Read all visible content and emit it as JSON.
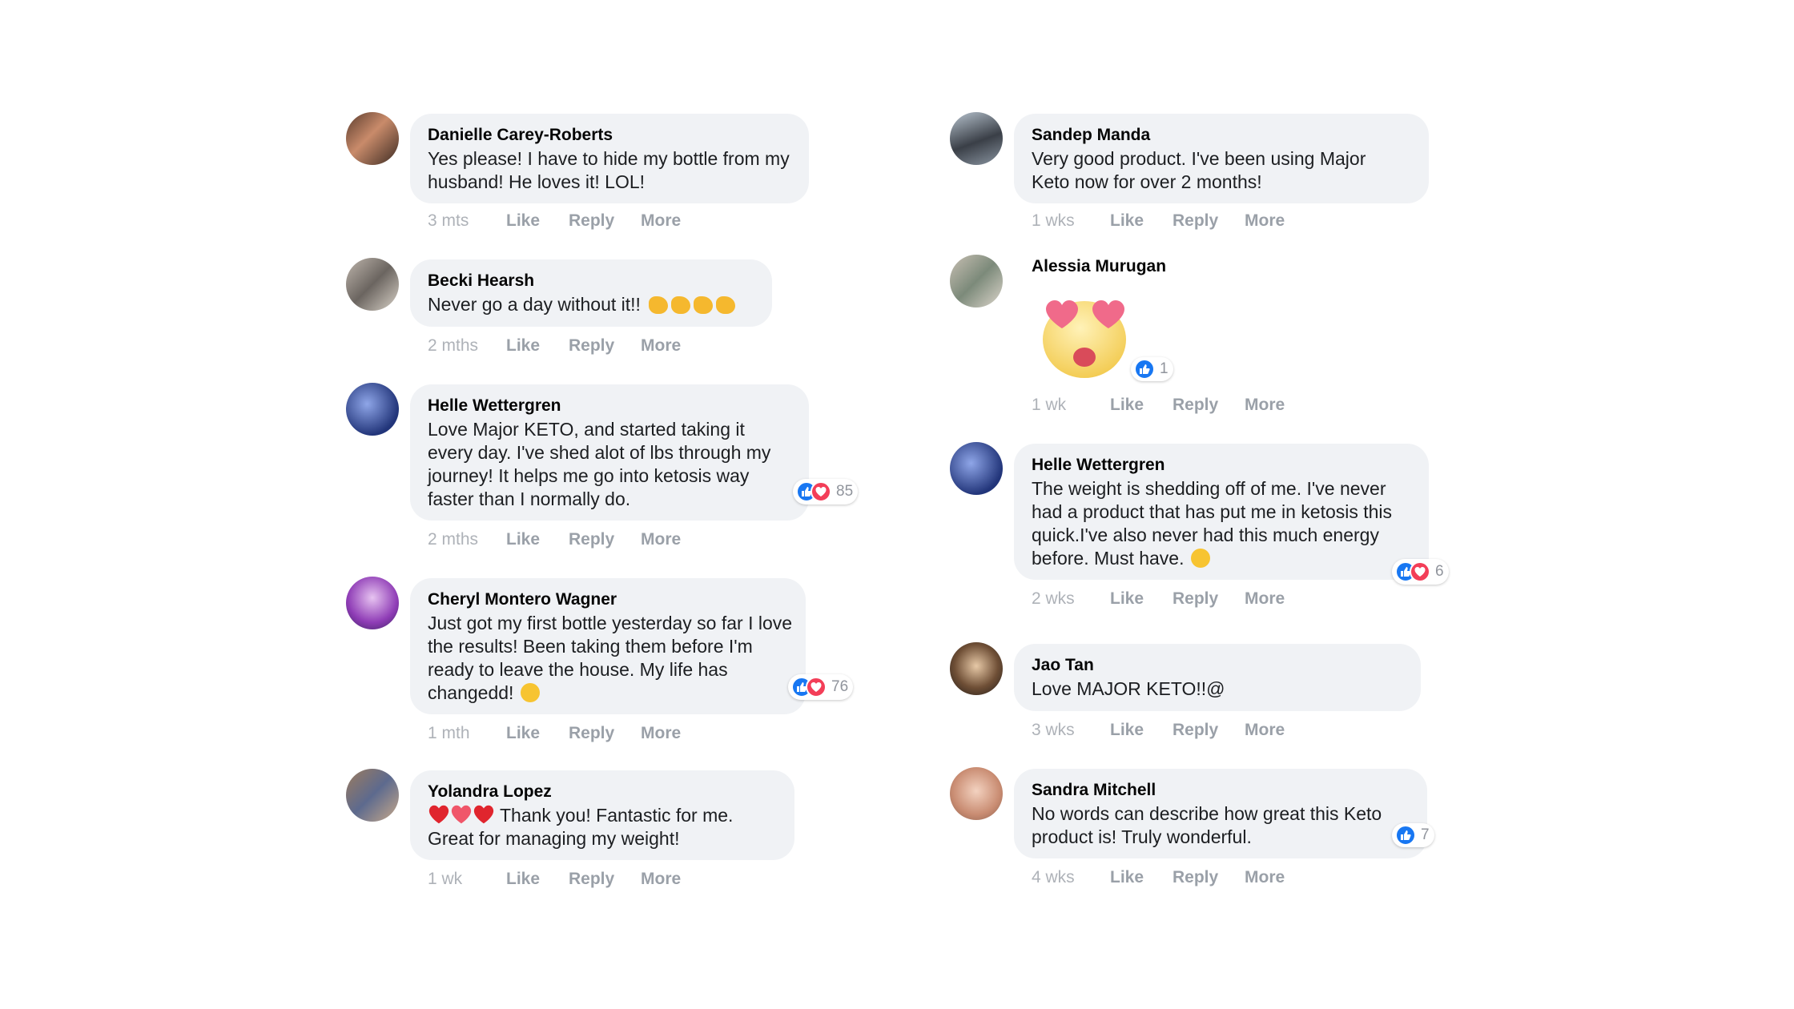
{
  "actions": {
    "like": "Like",
    "reply": "Reply",
    "more": "More"
  },
  "colors": {
    "like_blue": "#1877f2",
    "love_red": "#f33e58",
    "bubble_bg": "#f0f2f5"
  },
  "left_comments": [
    {
      "author": "Danielle Carey-Roberts",
      "text": "Yes please! I have to hide my bottle from my husband! He loves it! LOL!",
      "time": "3 mts",
      "avatar": "avatar-photo"
    },
    {
      "author": "Becki Hearsh",
      "text": "Never go a day without it!!",
      "emoji": "clapping-hands x4",
      "time": "2 mths",
      "avatar": "avatar-photo"
    },
    {
      "author": "Helle Wettergren",
      "text": "Love Major KETO, and started taking it every day. I've shed alot of lbs through my journey! It helps me go into ketosis way faster than I normally do.",
      "reactions": "85",
      "time": "2 mths",
      "avatar": "avatar-photo"
    },
    {
      "author": "Cheryl Montero Wagner",
      "text": "Just got my first bottle yesterday so far I love the results! Been taking them before I'm ready to leave the house. My life has changedd!",
      "emoji": "star-struck",
      "reactions": "76",
      "time": "1 mth",
      "avatar": "avatar-photo"
    },
    {
      "author": "Yolandra Lopez",
      "text_prefix": "hearts",
      "text": "Thank you! Fantastic for me. Great for managing my weight!",
      "time": "1 wk",
      "avatar": "avatar-photo"
    }
  ],
  "right_comments": [
    {
      "author": "Sandep Manda",
      "text": "Very good product. I've been using Major Keto now for over 2 months!",
      "time": "1 wks",
      "avatar": "avatar-photo"
    },
    {
      "author": "Alessia Murugan",
      "sticker": "heart-eyes-emoji",
      "reactions": "1",
      "time": "1 wk",
      "avatar": "avatar-photo"
    },
    {
      "author": "Helle Wettergren",
      "text": "The weight is shedding off of me. I've never had a product that has put me in ketosis this quick.I've also never had this much energy before. Must have.",
      "emoji": "smiling",
      "reactions": "6",
      "time": "2 wks",
      "avatar": "avatar-photo"
    },
    {
      "author": "Jao Tan",
      "text": "Love MAJOR KETO!!@",
      "time": "3 wks",
      "avatar": "avatar-photo"
    },
    {
      "author": "Sandra Mitchell",
      "text": "No words can describe how great this Keto product is! Truly wonderful.",
      "reactions": "7",
      "time": "4 wks",
      "avatar": "avatar-photo"
    }
  ]
}
